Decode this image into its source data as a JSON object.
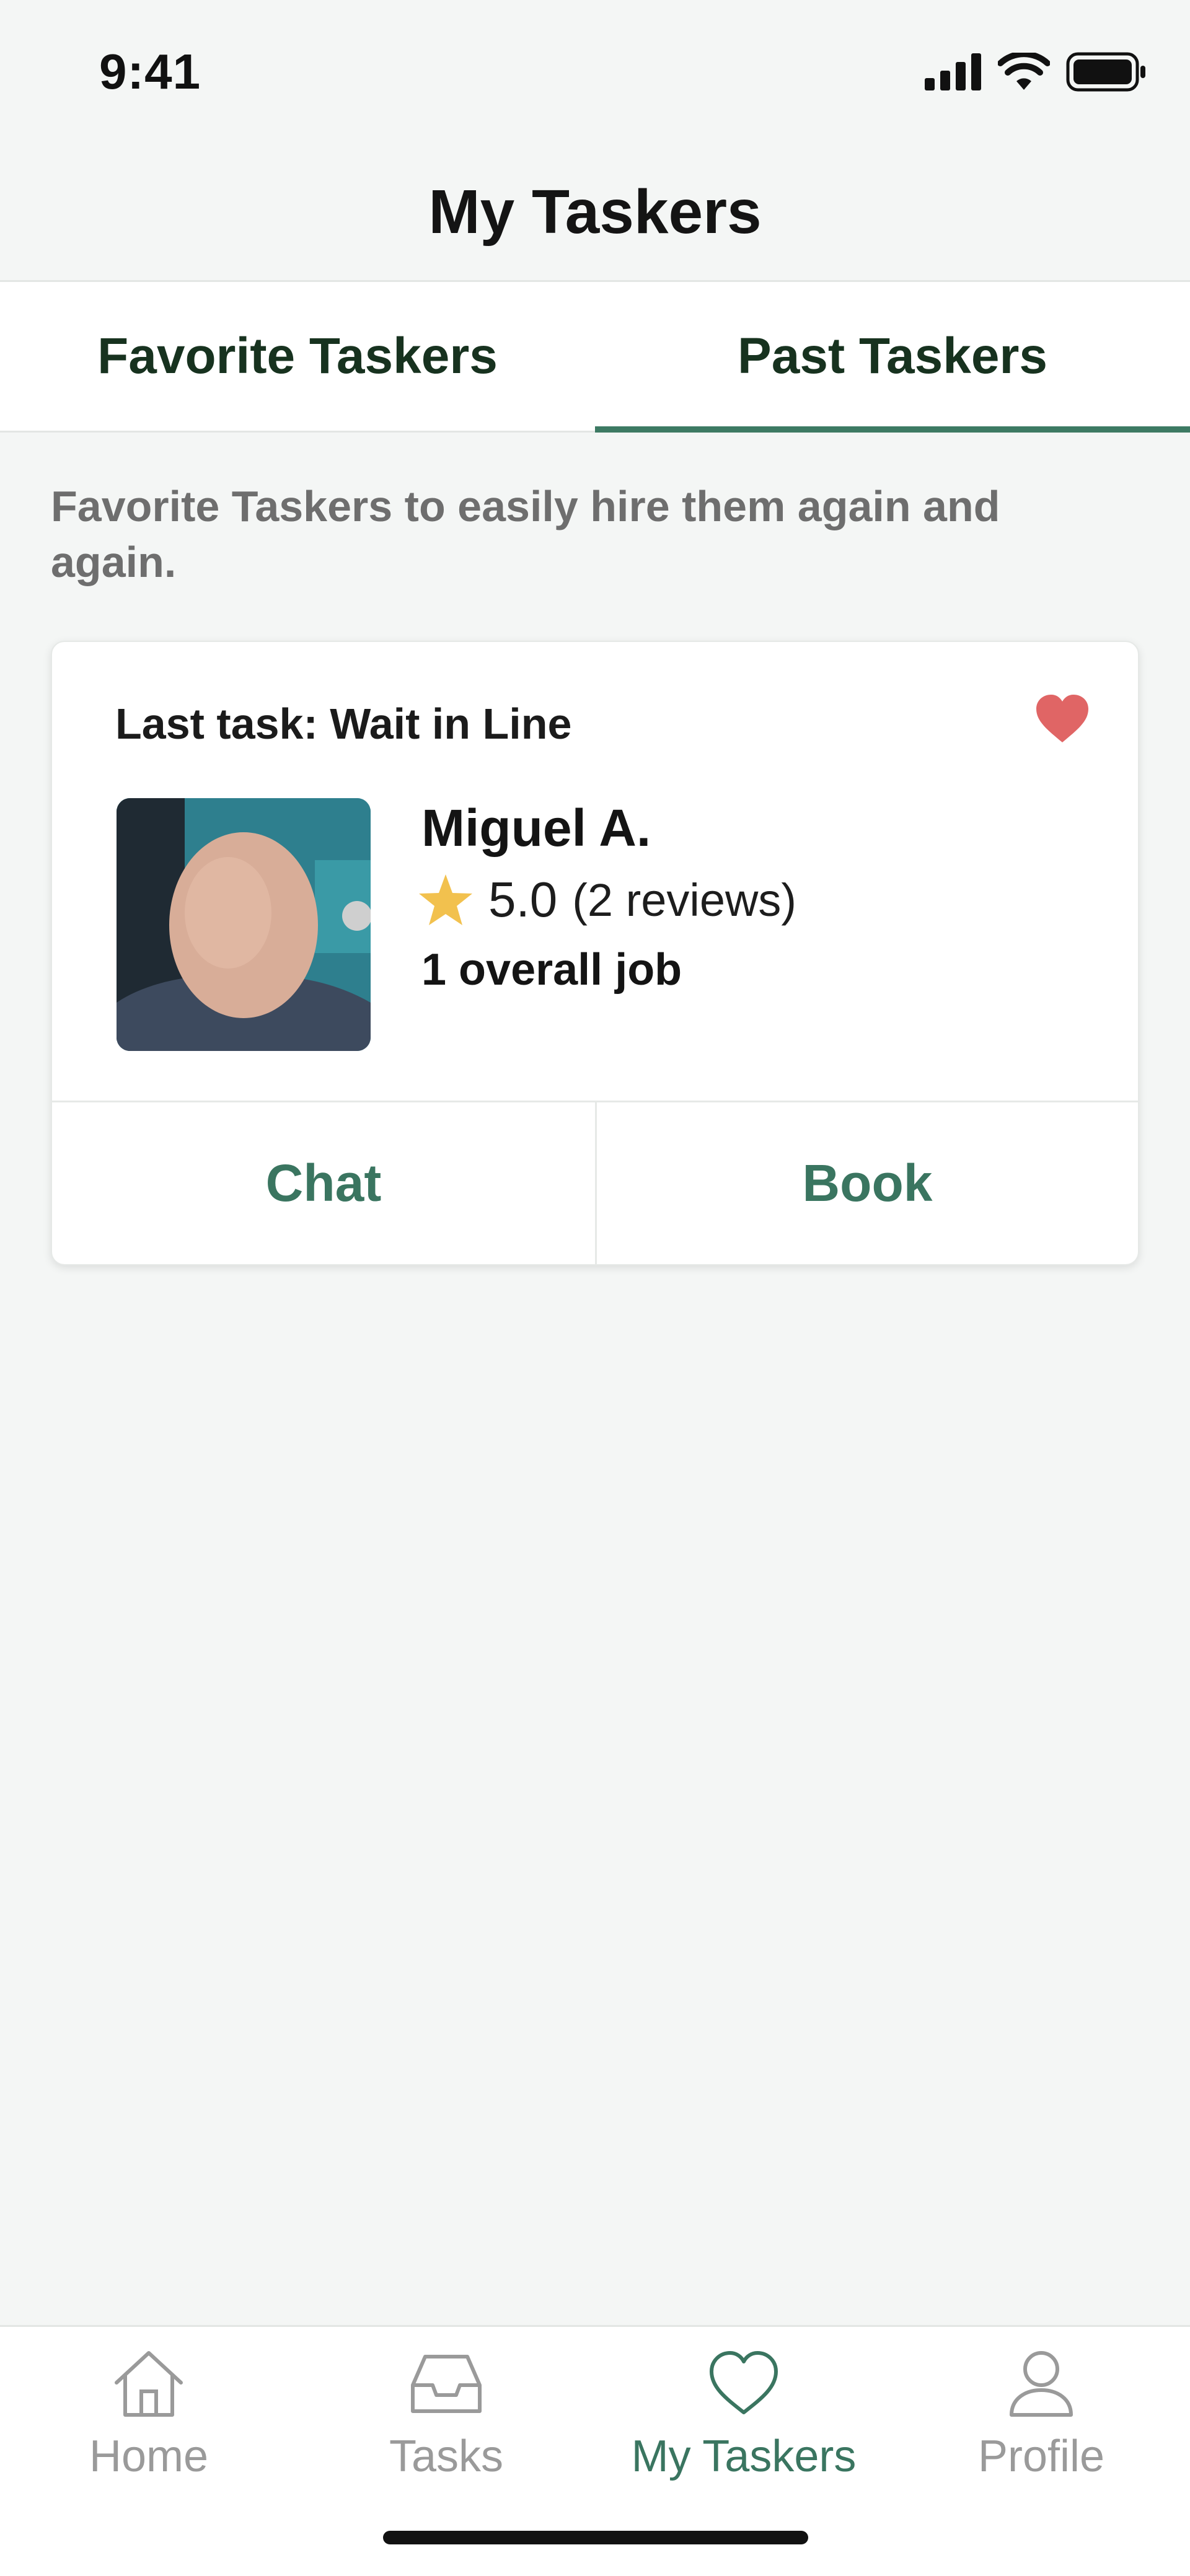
{
  "status_bar": {
    "time": "9:41"
  },
  "header": {
    "title": "My Taskers"
  },
  "tabs": [
    {
      "label": "Favorite Taskers",
      "active": false
    },
    {
      "label": "Past Taskers",
      "active": true
    }
  ],
  "helper_text": "Favorite Taskers to easily hire them again and again.",
  "card": {
    "last_task": "Last task: Wait in Line",
    "name": "Miguel A.",
    "rating": "5.0",
    "reviews": "(2 reviews)",
    "jobs": "1 overall job",
    "favorite_icon": "heart-icon",
    "favorite_color": "#e06565",
    "chat_label": "Chat",
    "book_label": "Book"
  },
  "bottom_nav": {
    "items": [
      {
        "label": "Home",
        "icon": "home-icon",
        "active": false
      },
      {
        "label": "Tasks",
        "icon": "inbox-icon",
        "active": false
      },
      {
        "label": "My Taskers",
        "icon": "heart-icon",
        "active": true
      },
      {
        "label": "Profile",
        "icon": "person-icon",
        "active": false
      }
    ]
  },
  "colors": {
    "accent": "#3a7560",
    "star": "#f2c14e",
    "heart": "#e06565"
  }
}
